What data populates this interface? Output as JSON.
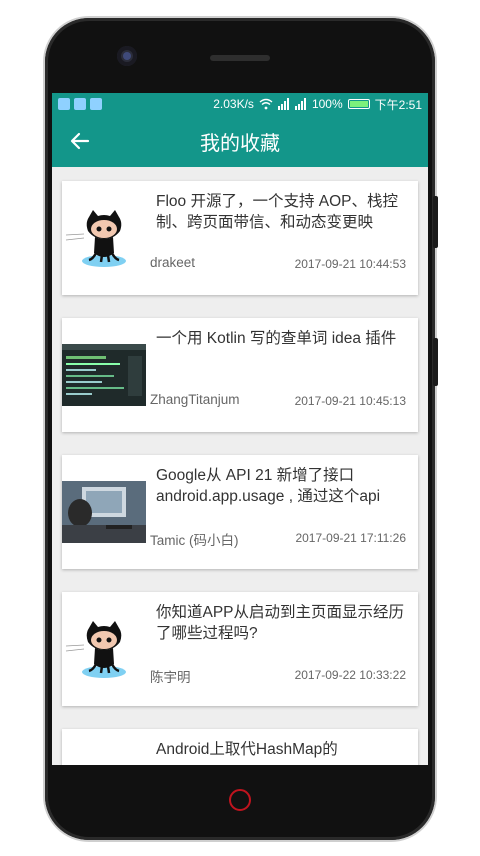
{
  "status_bar": {
    "speed": "2.03K/s",
    "battery": "100%",
    "time": "下午2:51"
  },
  "app_bar": {
    "title": "我的收藏",
    "back_icon": "arrow-left-icon"
  },
  "items": [
    {
      "title": "Floo 开源了，一个支持 AOP、栈控制、跨页面带信、和动态变更映",
      "author": "drakeet",
      "time": "2017-09-21 10:44:53",
      "thumb": "octocat"
    },
    {
      "title": "一个用 Kotlin 写的查单词 idea 插件",
      "author": "ZhangTitanjum",
      "time": "2017-09-21 10:45:13",
      "thumb": "code-screenshot"
    },
    {
      "title": "Google从 API 21 新增了接口 android.app.usage , 通过这个api",
      "author": "Tamic (码小白)",
      "time": "2017-09-21 17:11:26",
      "thumb": "desk-photo"
    },
    {
      "title": "你知道APP从启动到主页面显示经历了哪些过程吗?",
      "author": "陈宇明",
      "time": "2017-09-22 10:33:22",
      "thumb": "octocat"
    },
    {
      "title": "Android上取代HashMap的",
      "author": "",
      "time": "",
      "thumb": ""
    }
  ],
  "colors": {
    "primary": "#13968a",
    "home_button": "#c0141e"
  }
}
